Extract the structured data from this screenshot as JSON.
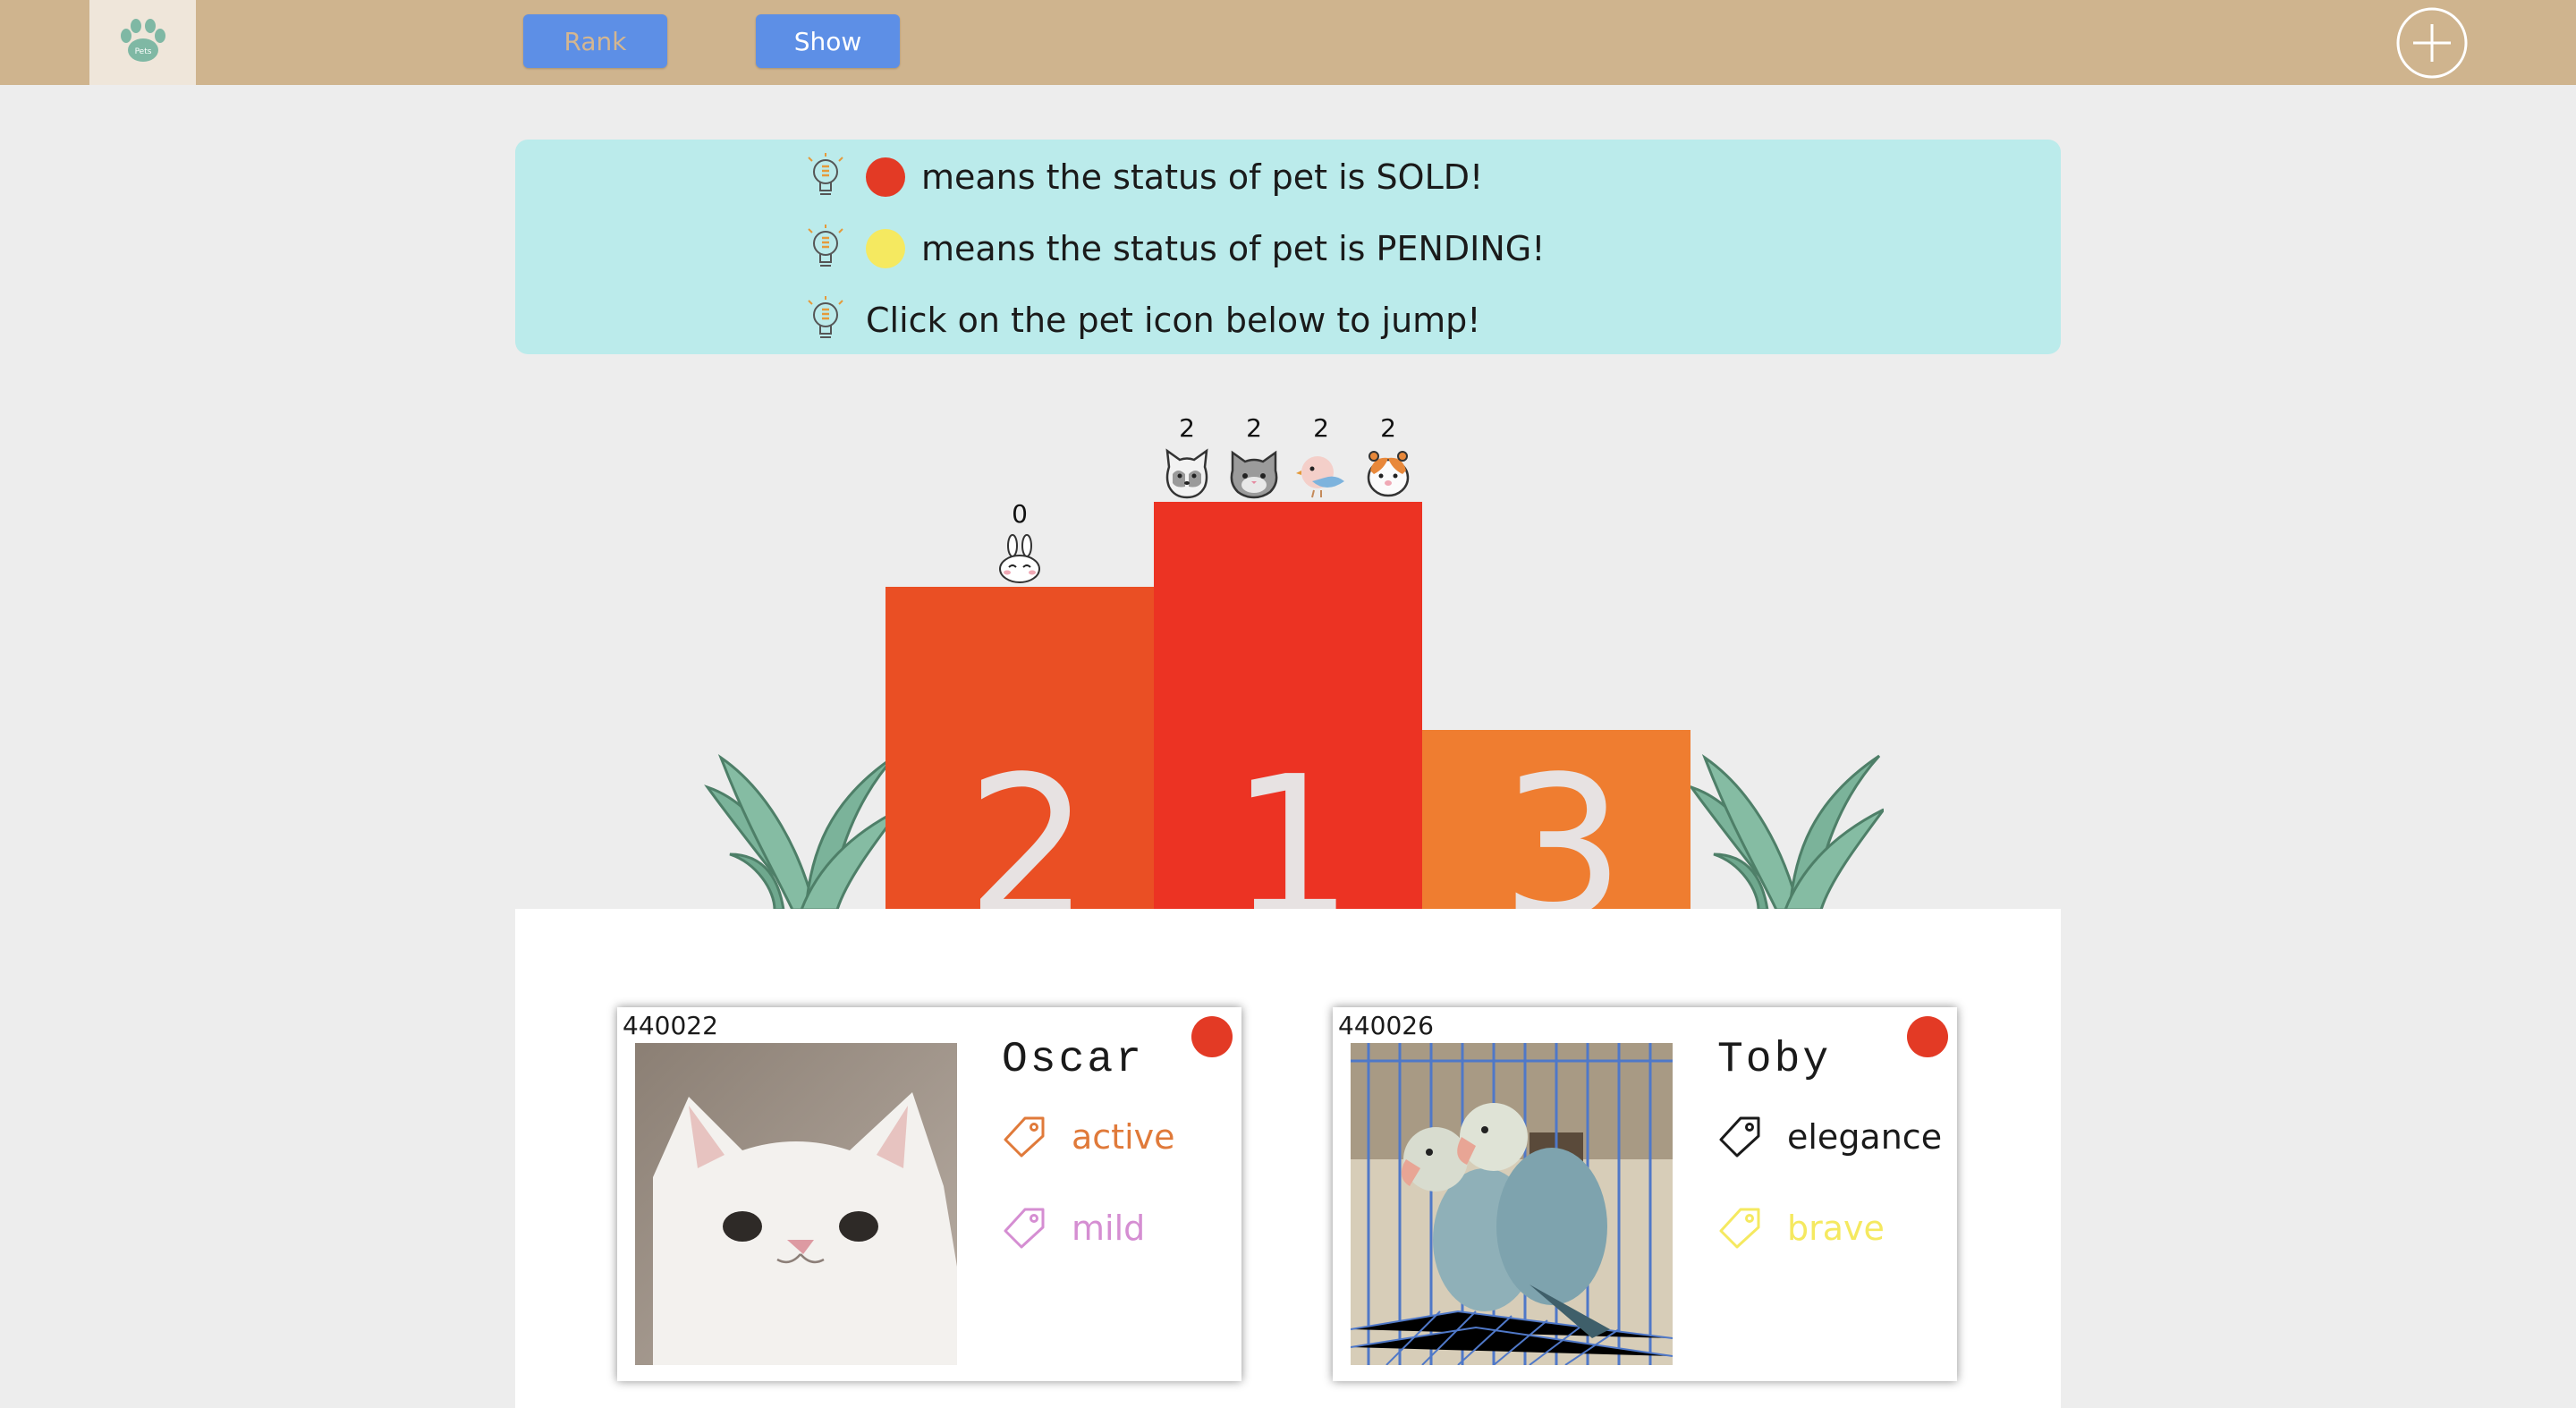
{
  "header": {
    "logo_icon": "paw-logo-icon",
    "logo_text": "Pets",
    "rank_label": "Rank",
    "show_label": "Show",
    "add_icon": "plus-circle-icon"
  },
  "info": {
    "sold_text": "means the status of pet is SOLD!",
    "pending_text": "means the status of pet is PENDING!",
    "jump_text": "Click on the pet icon below to jump!",
    "sold_color": "#e33a25",
    "pending_color": "#f5e960"
  },
  "podium": {
    "first": {
      "number": "1",
      "color": "#ec3323"
    },
    "second": {
      "number": "2",
      "color": "#ea4f24"
    },
    "third": {
      "number": "3",
      "color": "#ef7d30"
    },
    "pets": [
      {
        "type": "dog",
        "count": "2",
        "icon": "dog-icon"
      },
      {
        "type": "cat",
        "count": "2",
        "icon": "cat-icon"
      },
      {
        "type": "bird",
        "count": "2",
        "icon": "bird-icon"
      },
      {
        "type": "hamster",
        "count": "2",
        "icon": "hamster-icon"
      },
      {
        "type": "rabbit",
        "count": "0",
        "icon": "rabbit-icon"
      }
    ]
  },
  "cards": [
    {
      "id": "440022",
      "name": "Oscar",
      "status_color": "#e33a25",
      "photo": "white-cat-photo",
      "tags": [
        {
          "label": "active",
          "color": "#e07a3a"
        },
        {
          "label": "mild",
          "color": "#d58ed2"
        }
      ]
    },
    {
      "id": "440026",
      "name": "Toby",
      "status_color": "#e33a25",
      "photo": "lovebirds-photo",
      "tags": [
        {
          "label": "elegance",
          "color": "#1a1a1a"
        },
        {
          "label": "brave",
          "color": "#f5e960"
        }
      ]
    }
  ]
}
